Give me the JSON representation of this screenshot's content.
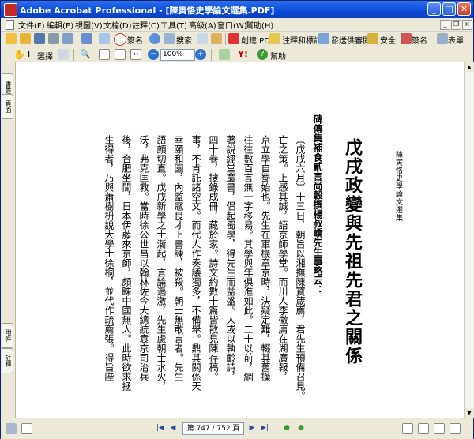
{
  "window": {
    "title": "Adobe Acrobat Professional - [陳寅恪史學論文選集.PDF]",
    "minimize": "_",
    "maximize": "□",
    "close": "✕"
  },
  "menu": {
    "items": [
      "文件(F)",
      "編輯(E)",
      "視圖(V)",
      "文檔(D)",
      "註釋(C)",
      "工具(T)",
      "高級(A)",
      "窗口(W)",
      "幫助(H)"
    ]
  },
  "toolbar1": {
    "search_label": "搜索",
    "sign_label": "簽名",
    "create_pdf_label": "創建 PDF",
    "comment_label": "注釋和標記",
    "send_label": "發送供審閱",
    "security_label": "安全",
    "signature_label": "簽名",
    "forms_label": "表單"
  },
  "toolbar2": {
    "select_label": "選擇",
    "zoom_value": "100%",
    "help_label": "幫助",
    "yahoo_label": "Y!"
  },
  "sidebar": {
    "tabs": [
      "書簽",
      "頁面",
      "附件",
      "註釋"
    ]
  },
  "document": {
    "header_right": "陳寅恪史學論文選集",
    "title": "戊戌政變與先祖先君之關係",
    "subtitle": "碑傳集補食貳言尚穀撰楊叔嶠先生事略云：",
    "columns": [
      "〔戊戌六月〕十三日，朝旨以湘撫陳寶箴薦，君先生預備召見。",
      "亡之策。上感其誠，語京師學堂。而川人李徵庸在湖廣報，",
      "京立學自蜀始也。先生在軍機章京時，決疑定難，輟其舊操",
      "往往數百言無一字移易。其學與年俱進如此。二十以前，網",
      "著說經堂叢書，倡起蜀學，得先生而益盛。人或以執齡詩，",
      "四十卷，搜錄成冊，藏於家。詩文約數十篇皆散見陳存稿。",
      "事，不肯託諸空文。而代人作奏議獨多，不備舉。鼎其關係天",
      "幸頤和園，內監寇良才上書諫，被殺。朝士無敢言者。先生",
      "語頗切直。戊戌新學之士漸起，言論過激，先生慮朝士水火，",
      "沃，弗克匡救。當時徐公世昌以翰林佐今大總統袁京司治兵",
      "後，合肥坐閒，日本伊藤來京師，頗睞中國無人。此時欲求拯",
      "生得者，乃與蕭樹枬說大學士徐桐，並代作疏薦張。得旨陛"
    ]
  },
  "statusbar": {
    "page_indicator": "第 747 / 752 頁"
  }
}
